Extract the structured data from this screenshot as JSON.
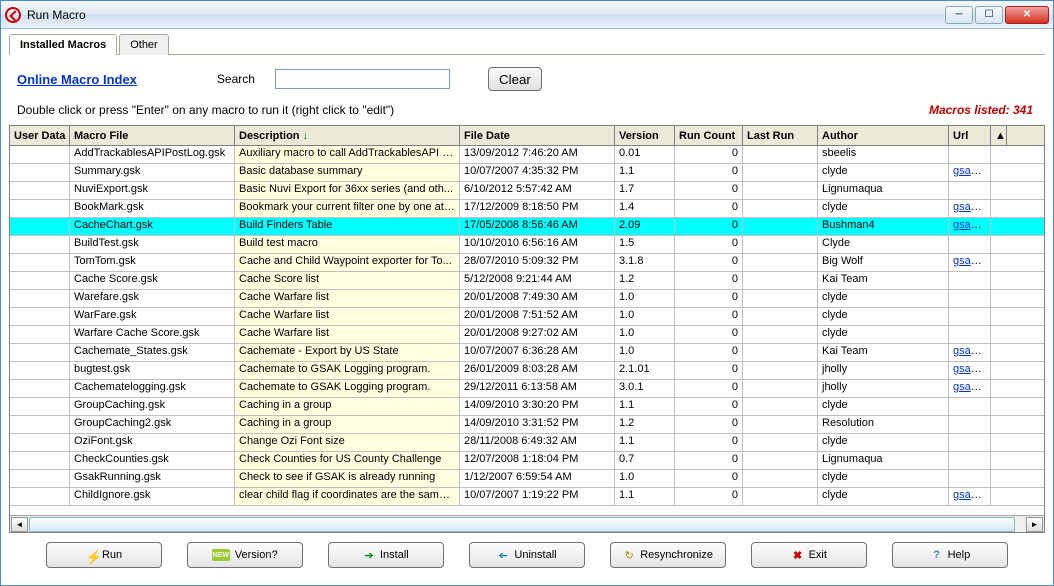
{
  "window": {
    "title": "Run Macro"
  },
  "tabs": {
    "installed": "Installed Macros",
    "other": "Other"
  },
  "top": {
    "online_link": "Online Macro Index",
    "search_label": "Search",
    "clear_btn": "Clear",
    "hint": "Double click or press \"Enter\" on any macro to run it (right click to \"edit\")",
    "count_label": "Macros listed: 341"
  },
  "columns": {
    "user_data": "User Data",
    "macro_file": "Macro File",
    "description": "Description",
    "file_date": "File Date",
    "version": "Version",
    "run_count": "Run Count",
    "last_run": "Last Run",
    "author": "Author",
    "url": "Url"
  },
  "rows": [
    {
      "ud": "",
      "mf": "AddTrackablesAPIPostLog.gsk",
      "desc": "Auxiliary macro to call AddTrackablesAPI fo...",
      "fd": "13/09/2012 7:46:20 AM",
      "ver": "0.01",
      "rc": "0",
      "lr": "",
      "auth": "sbeelis",
      "url": "",
      "sel": false
    },
    {
      "ud": "",
      "mf": "Summary.gsk",
      "desc": "Basic database summary",
      "fd": "10/07/2007 4:35:32 PM",
      "ver": "1.1",
      "rc": "0",
      "lr": "",
      "auth": "clyde",
      "url": "gsak.ne",
      "sel": false
    },
    {
      "ud": "",
      "mf": "NuviExport.gsk",
      "desc": "Basic Nuvi Export for 36xx series (and oth...",
      "fd": "6/10/2012 5:57:42 AM",
      "ver": "1.7",
      "rc": "0",
      "lr": "",
      "auth": "Lignumaqua",
      "url": "",
      "sel": false
    },
    {
      "ud": "",
      "mf": "BookMark.gsk",
      "desc": "Bookmark your current filter one by one at ...",
      "fd": "17/12/2009 8:18:50 PM",
      "ver": "1.4",
      "rc": "0",
      "lr": "",
      "auth": "clyde",
      "url": "gsak.ne",
      "sel": false
    },
    {
      "ud": "",
      "mf": "CacheChart.gsk",
      "desc": "Build Finders Table",
      "fd": "17/05/2008 8:56:46 AM",
      "ver": "2.09",
      "rc": "0",
      "lr": "",
      "auth": "Bushman4",
      "url": "gsak.ne",
      "sel": true
    },
    {
      "ud": "",
      "mf": "BuildTest.gsk",
      "desc": "Build test macro",
      "fd": "10/10/2010 6:56:16 AM",
      "ver": "1.5",
      "rc": "0",
      "lr": "",
      "auth": "Clyde",
      "url": "",
      "sel": false
    },
    {
      "ud": "",
      "mf": "TomTom.gsk",
      "desc": "Cache and Child Waypoint exporter for To...",
      "fd": "28/07/2010 5:09:32 PM",
      "ver": "3.1.8",
      "rc": "0",
      "lr": "",
      "auth": "Big Wolf",
      "url": "gsak.ne",
      "sel": false
    },
    {
      "ud": "",
      "mf": "Cache Score.gsk",
      "desc": "Cache Score list",
      "fd": "5/12/2008 9:21:44 AM",
      "ver": "1.2",
      "rc": "0",
      "lr": "",
      "auth": "Kai Team",
      "url": "",
      "sel": false
    },
    {
      "ud": "",
      "mf": "Warefare.gsk",
      "desc": "Cache Warfare list",
      "fd": "20/01/2008 7:49:30 AM",
      "ver": "1.0",
      "rc": "0",
      "lr": "",
      "auth": "clyde",
      "url": "",
      "sel": false
    },
    {
      "ud": "",
      "mf": "WarFare.gsk",
      "desc": "Cache Warfare list",
      "fd": "20/01/2008 7:51:52 AM",
      "ver": "1.0",
      "rc": "0",
      "lr": "",
      "auth": "clyde",
      "url": "",
      "sel": false
    },
    {
      "ud": "",
      "mf": "Warfare Cache Score.gsk",
      "desc": "Cache Warfare list",
      "fd": "20/01/2008 9:27:02 AM",
      "ver": "1.0",
      "rc": "0",
      "lr": "",
      "auth": "clyde",
      "url": "",
      "sel": false
    },
    {
      "ud": "",
      "mf": "Cachemate_States.gsk",
      "desc": "Cachemate - Export by US State",
      "fd": "10/07/2007 6:36:28 AM",
      "ver": "1.0",
      "rc": "0",
      "lr": "",
      "auth": "Kai Team",
      "url": "gsak.ne",
      "sel": false
    },
    {
      "ud": "",
      "mf": "bugtest.gsk",
      "desc": "Cachemate to GSAK Logging program.",
      "fd": "26/01/2009 8:03:28 AM",
      "ver": "2.1.01",
      "rc": "0",
      "lr": "",
      "auth": "jholly",
      "url": "gsak.ne",
      "sel": false
    },
    {
      "ud": "",
      "mf": "Cachematelogging.gsk",
      "desc": "Cachemate to GSAK Logging program.",
      "fd": "29/12/2011 6:13:58 AM",
      "ver": "3.0.1",
      "rc": "0",
      "lr": "",
      "auth": "jholly",
      "url": "gsak.ne",
      "sel": false
    },
    {
      "ud": "",
      "mf": "GroupCaching.gsk",
      "desc": "Caching in a group",
      "fd": "14/09/2010 3:30:20 PM",
      "ver": "1.1",
      "rc": "0",
      "lr": "",
      "auth": "clyde",
      "url": "",
      "sel": false
    },
    {
      "ud": "",
      "mf": "GroupCaching2.gsk",
      "desc": "Caching in a group",
      "fd": "14/09/2010 3:31:52 PM",
      "ver": "1.2",
      "rc": "0",
      "lr": "",
      "auth": "Resolution",
      "url": "",
      "sel": false
    },
    {
      "ud": "",
      "mf": "OziFont.gsk",
      "desc": "Change Ozi Font size",
      "fd": "28/11/2008 6:49:32 AM",
      "ver": "1.1",
      "rc": "0",
      "lr": "",
      "auth": "clyde",
      "url": "",
      "sel": false
    },
    {
      "ud": "",
      "mf": "CheckCounties.gsk",
      "desc": "Check Counties for US County Challenge",
      "fd": "12/07/2008 1:18:04 PM",
      "ver": "0.7",
      "rc": "0",
      "lr": "",
      "auth": "Lignumaqua",
      "url": "",
      "sel": false
    },
    {
      "ud": "",
      "mf": "GsakRunning.gsk",
      "desc": "Check to see if GSAK is already running",
      "fd": "1/12/2007 6:59:54 AM",
      "ver": "1.0",
      "rc": "0",
      "lr": "",
      "auth": "clyde",
      "url": "",
      "sel": false
    },
    {
      "ud": "",
      "mf": "ChildIgnore.gsk",
      "desc": "clear child flag if coordinates are the same ...",
      "fd": "10/07/2007 1:19:22 PM",
      "ver": "1.1",
      "rc": "0",
      "lr": "",
      "auth": "clyde",
      "url": "gsak.ne",
      "sel": false
    }
  ],
  "buttons": {
    "run": "Run",
    "version": "Version?",
    "install": "Install",
    "uninstall": "Uninstall",
    "resync": "Resynchronize",
    "exit": "Exit",
    "help": "Help"
  },
  "colors": {
    "accent_sel": "#00ffff",
    "url_link": "#0033cc",
    "count_text": "#c00000"
  }
}
